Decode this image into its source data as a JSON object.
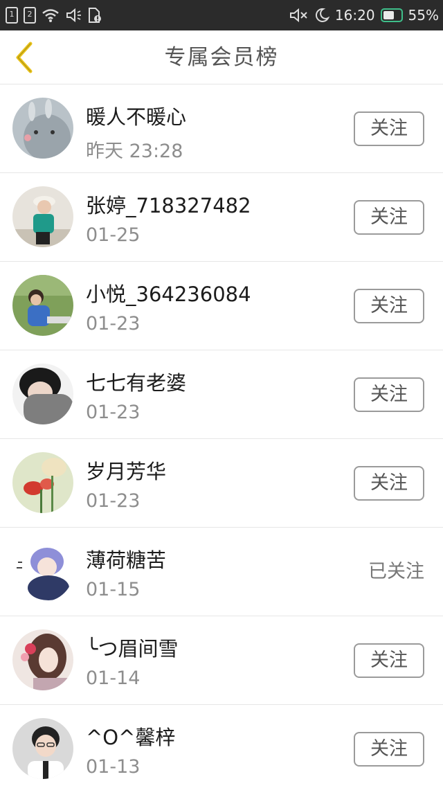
{
  "status_bar": {
    "sim1": "1",
    "sim2": "2",
    "time": "16:20",
    "battery": "55%",
    "battery_level": 0.55
  },
  "header": {
    "title": "专属会员榜"
  },
  "members": [
    {
      "name": "暖人不暖心",
      "time": "昨天 23:28",
      "action": "关注",
      "followed": false
    },
    {
      "name": "张婷_718327482",
      "time": "01-25",
      "action": "关注",
      "followed": false
    },
    {
      "name": "小悦_364236084",
      "time": "01-23",
      "action": "关注",
      "followed": false
    },
    {
      "name": "七七有老婆",
      "time": "01-23",
      "action": "关注",
      "followed": false
    },
    {
      "name": "岁月芳华",
      "time": "01-23",
      "action": "关注",
      "followed": false
    },
    {
      "name": "薄荷糖苦",
      "time": "01-15",
      "action": "已关注",
      "followed": true
    },
    {
      "name": "╰つ眉间雪",
      "time": "01-14",
      "action": "关注",
      "followed": false
    },
    {
      "name": "^O^馨梓",
      "time": "01-13",
      "action": "关注",
      "followed": false
    }
  ],
  "colors": {
    "status_bar_bg": "#2b2b2b",
    "back_arrow": "#e8c21a",
    "battery_accent": "#3fbf8a"
  }
}
